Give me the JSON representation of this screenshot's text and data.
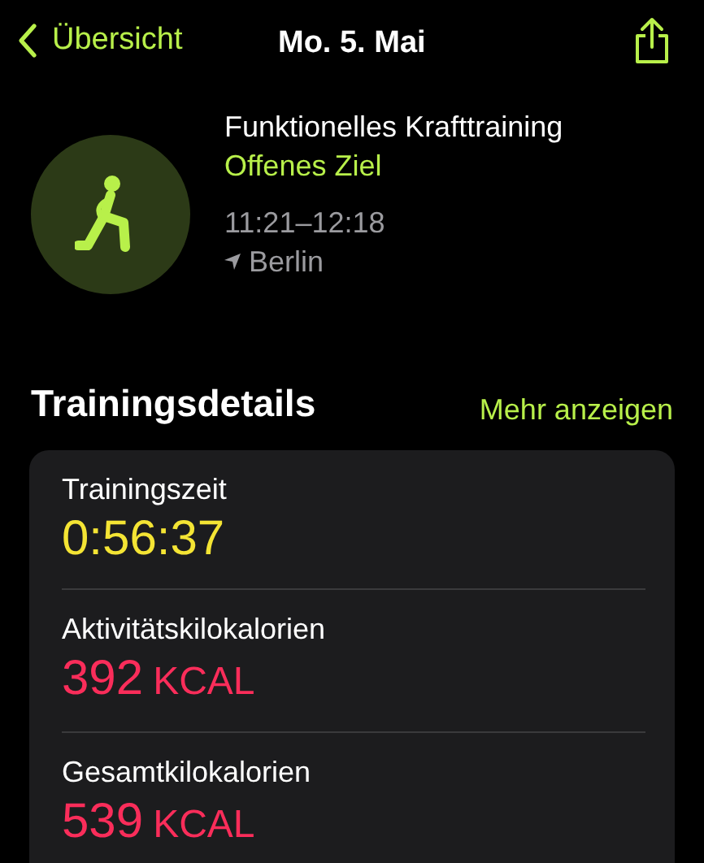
{
  "nav": {
    "back": "Übersicht",
    "title": "Mo. 5. Mai"
  },
  "workout": {
    "name": "Funktionelles Krafttraining",
    "goal": "Offenes Ziel",
    "time": "11:21–12:18",
    "location": "Berlin"
  },
  "section": {
    "title": "Trainingsdetails",
    "more": "Mehr anzeigen"
  },
  "metrics": [
    {
      "label": "Trainingszeit",
      "value": "0:56:37",
      "color": "#f4e434"
    },
    {
      "label": "Aktivitätskilokalorien",
      "value": "392",
      "unit": "KCAL",
      "color": "#fa2d5a"
    },
    {
      "label": "Gesamtkilokalorien",
      "value": "539",
      "unit": "KCAL",
      "color": "#fa2d5a"
    }
  ]
}
